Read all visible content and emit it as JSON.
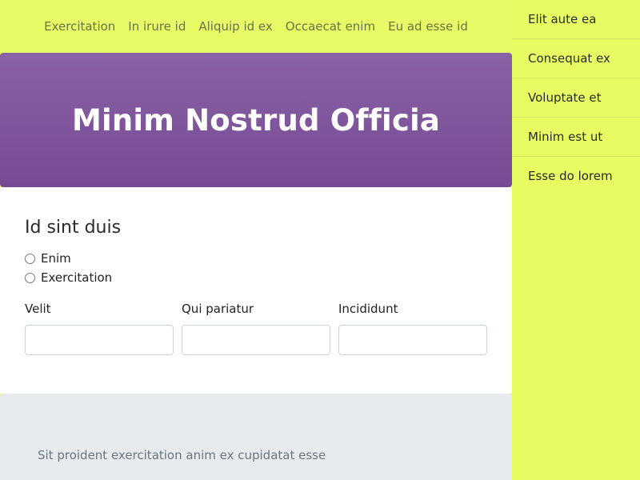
{
  "topnav": {
    "links": [
      "Exercitation",
      "In irure id",
      "Aliquip id ex",
      "Occaecat enim",
      "Eu ad esse id"
    ]
  },
  "hero": {
    "title": "Minim Nostrud Officia"
  },
  "form": {
    "heading": "Id sint duis",
    "radios": [
      "Enim",
      "Exercitation"
    ],
    "fields": [
      {
        "label": "Velit",
        "value": ""
      },
      {
        "label": "Qui pariatur",
        "value": ""
      },
      {
        "label": "Incididunt",
        "value": ""
      }
    ]
  },
  "footer": {
    "text": "Sit proident exercitation anim ex cupidatat esse"
  },
  "sidebar": {
    "items": [
      "Elit aute ea",
      "Consequat ex",
      "Voluptate et",
      "Minim est ut",
      "Esse do lorem"
    ]
  },
  "colors": {
    "page_bg": "#e8fc60",
    "hero_top": "#8a62a6",
    "hero_bottom": "#764a94",
    "footer_bg": "#e7ebee"
  }
}
